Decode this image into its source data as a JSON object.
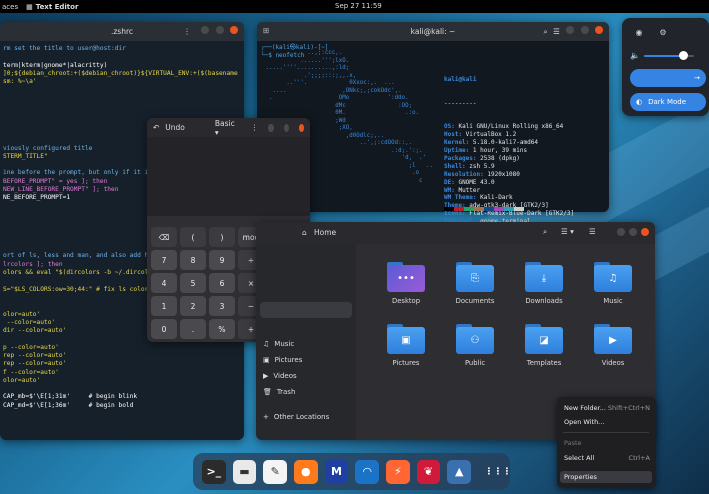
{
  "topbar": {
    "activities": "aces",
    "app_name": "Text Editor",
    "clock": "Sep 27  11:59"
  },
  "editor": {
    "title": ".zshrc",
    "lines": [
      {
        "t": "rm set the title to user@host:dir",
        "c": "c-comment"
      },
      {
        "t": "",
        "c": "c-plain"
      },
      {
        "t": "term|kterm|gnome*|alacritty)",
        "c": "c-plain"
      },
      {
        "t": "]0;${debian_chroot:+($debian_chroot)}${VIRTUAL_ENV:+($(basename",
        "c": "c-str"
      },
      {
        "t": "sm: %~\\a'",
        "c": "c-str"
      },
      {
        "t": "",
        "c": "c-plain"
      },
      {
        "t": "",
        "c": "c-plain"
      },
      {
        "t": "",
        "c": "c-plain"
      },
      {
        "t": "",
        "c": "c-plain"
      },
      {
        "t": "",
        "c": "c-plain"
      },
      {
        "t": "",
        "c": "c-plain"
      },
      {
        "t": "",
        "c": "c-plain"
      },
      {
        "t": "viously configured title",
        "c": "c-comment"
      },
      {
        "t": "STERM_TITLE\"",
        "c": "c-str"
      },
      {
        "t": "",
        "c": "c-plain"
      },
      {
        "t": "ine before the prompt, but only if it is",
        "c": "c-comment"
      },
      {
        "t": "BEFORE_PROMPT\" = yes ]; then",
        "c": "c-kw"
      },
      {
        "t": "NEW_LINE_BEFORE_PROMPT\" ]; then",
        "c": "c-kw"
      },
      {
        "t": "NE_BEFORE_PROMPT=1",
        "c": "c-plain"
      },
      {
        "t": "",
        "c": "c-plain"
      },
      {
        "t": "",
        "c": "c-plain"
      },
      {
        "t": "",
        "c": "c-plain"
      },
      {
        "t": "",
        "c": "c-plain"
      },
      {
        "t": "",
        "c": "c-plain"
      },
      {
        "t": "",
        "c": "c-plain"
      },
      {
        "t": "ort of ls, less and man, and also add ha",
        "c": "c-comment"
      },
      {
        "t": "lrcolors ]; then",
        "c": "c-kw"
      },
      {
        "t": "olors && eval \"$(dircolors -b ~/.dircolor",
        "c": "c-str"
      },
      {
        "t": "",
        "c": "c-plain"
      },
      {
        "t": "S=\"$LS_COLORS:ow=30;44:\" # fix ls color",
        "c": "c-str"
      },
      {
        "t": "",
        "c": "c-plain"
      },
      {
        "t": "",
        "c": "c-plain"
      },
      {
        "t": "olor=auto'",
        "c": "c-str"
      },
      {
        "t": " --color=auto'",
        "c": "c-str"
      },
      {
        "t": "dir --color=auto'",
        "c": "c-str"
      },
      {
        "t": "",
        "c": "c-plain"
      },
      {
        "t": "p --color=auto'",
        "c": "c-str"
      },
      {
        "t": "rep --color=auto'",
        "c": "c-str"
      },
      {
        "t": "rep --color=auto'",
        "c": "c-str"
      },
      {
        "t": "f --color=auto'",
        "c": "c-str"
      },
      {
        "t": "olor=auto'",
        "c": "c-str"
      },
      {
        "t": "",
        "c": "c-plain"
      },
      {
        "t": "CAP_mb=$'\\E[1;31m'     # begin blink",
        "c": "c-plain"
      },
      {
        "t": "CAP_md=$'\\E[1;36m'     # begin bold",
        "c": "c-plain"
      }
    ]
  },
  "terminal": {
    "title": "kali@kali: ~",
    "prompt": "┌──(kali㉿kali)-[~]",
    "command": "└─$ neofetch",
    "user_host": "kali@kali",
    "separator": "---------",
    "info": [
      {
        "k": "OS:",
        "v": " Kali GNU/Linux Rolling x86_64"
      },
      {
        "k": "Host:",
        "v": " VirtualBox 1.2"
      },
      {
        "k": "Kernel:",
        "v": " 5.18.0-kali7-amd64"
      },
      {
        "k": "Uptime:",
        "v": " 1 hour, 39 mins"
      },
      {
        "k": "Packages:",
        "v": " 2538 (dpkg)"
      },
      {
        "k": "Shell:",
        "v": " zsh 5.9"
      },
      {
        "k": "Resolution:",
        "v": " 1920x1080"
      },
      {
        "k": "DE:",
        "v": " GNOME 43.0"
      },
      {
        "k": "WM:",
        "v": " Mutter"
      },
      {
        "k": "WM Theme:",
        "v": " Kali-Dark"
      },
      {
        "k": "Theme:",
        "v": " adw-gtk3-dark [GTK2/3]"
      },
      {
        "k": "Icons:",
        "v": " Flat-Remix-Blue-Dark [GTK2/3]"
      },
      {
        "k": "Terminal:",
        "v": " gnome-terminal"
      },
      {
        "k": "CPU:",
        "v": " AMD Ryzen 7 3700X (2) @ 3.599GHz"
      },
      {
        "k": "GPU:",
        "v": " 00:02.0 VMware SVGA II Adapter"
      },
      {
        "k": "Memory:",
        "v": " 1928MiB / 3929MiB"
      }
    ],
    "ascii": "             ..,;:ccc,.\n           ......''';lxO.\n .....''''..........,:ld;\n            .';;;;:::;,,.x,\n       ..'''.            0Xxoc:,.  ...\n   ....                ,ONkc;,;cokOdc',.\n  .                   OMo           ':ddo.\n                     dMc               :OO;\n                     0M.                 .:o.\n                     ;Wd\n                      ;XO,\n                        ,d0Odlc;,..\n                            ..',;:cdOOd::,.\n                                     .:d;.':;.\n                                        'd,  .'\n                                          ;l   ..\n                                           .o\n                                             c",
    "swatches": [
      "#000000",
      "#c01c28",
      "#26a269",
      "#a2734c",
      "#12488b",
      "#a347ba",
      "#2aa1b3",
      "#d0cfcc"
    ]
  },
  "quick_settings": {
    "icons": [
      "camera-icon",
      "gear-icon"
    ],
    "volume_level": 0.78,
    "pill1_label": "",
    "pill2_label": "Dark Mode"
  },
  "calculator": {
    "title": "Undo",
    "mode": "Basic",
    "keys": [
      "⌫",
      "(",
      ")",
      "mod",
      "π",
      "7",
      "8",
      "9",
      "÷",
      "√",
      "4",
      "5",
      "6",
      "×",
      "x²",
      "1",
      "2",
      "3",
      "−",
      "=",
      "0",
      ".",
      "%",
      "+"
    ]
  },
  "files": {
    "path": "Home",
    "sidebar": [
      {
        "label": "Music",
        "icon": "music-icon"
      },
      {
        "label": "Pictures",
        "icon": "pictures-icon"
      },
      {
        "label": "Videos",
        "icon": "videos-icon"
      },
      {
        "label": "Trash",
        "icon": "trash-icon"
      },
      {
        "label": "Other Locations",
        "icon": "plus-icon"
      }
    ],
    "folders": [
      {
        "label": "Desktop",
        "icon": "desktop-folder-icon",
        "glyph": "•••",
        "desk": true
      },
      {
        "label": "Documents",
        "icon": "documents-folder-icon",
        "glyph": "⎘"
      },
      {
        "label": "Downloads",
        "icon": "downloads-folder-icon",
        "glyph": "⤓"
      },
      {
        "label": "Music",
        "icon": "music-folder-icon",
        "glyph": "♫"
      },
      {
        "label": "Pictures",
        "icon": "pictures-folder-icon",
        "glyph": "▣"
      },
      {
        "label": "Public",
        "icon": "public-folder-icon",
        "glyph": "⚇"
      },
      {
        "label": "Templates",
        "icon": "templates-folder-icon",
        "glyph": "◪"
      },
      {
        "label": "Videos",
        "icon": "videos-folder-icon",
        "glyph": "▶"
      }
    ]
  },
  "context_menu": {
    "items": [
      {
        "label": "New Folder...",
        "shortcut": "Shift+Ctrl+N",
        "disabled": false
      },
      {
        "label": "Open With...",
        "shortcut": "",
        "disabled": false
      },
      {
        "label": "Paste",
        "shortcut": "",
        "disabled": true
      },
      {
        "label": "Select All",
        "shortcut": "Ctrl+A",
        "disabled": false
      },
      {
        "label": "Properties",
        "shortcut": "",
        "disabled": false
      }
    ]
  },
  "dock": {
    "apps": [
      {
        "name": "terminal-app",
        "glyph": ">_",
        "bg": "#2b2b2b"
      },
      {
        "name": "files-app",
        "glyph": "▬",
        "bg": "#e9e9e9"
      },
      {
        "name": "text-editor-app",
        "glyph": "✎",
        "bg": "#f4f4f4"
      },
      {
        "name": "firefox-app",
        "glyph": "●",
        "bg": "#ff7a1a"
      },
      {
        "name": "metasploit-app",
        "glyph": "M",
        "bg": "#1f3fa3"
      },
      {
        "name": "wireshark-app",
        "glyph": "◠",
        "bg": "#1a73c7"
      },
      {
        "name": "burpsuite-app",
        "glyph": "⚡",
        "bg": "#ff6633"
      },
      {
        "name": "cherrytree-app",
        "glyph": "❦",
        "bg": "#d11a3a"
      },
      {
        "name": "kali-tweaks-app",
        "glyph": "▲",
        "bg": "#3a6fb0"
      },
      {
        "name": "app-grid",
        "glyph": "⋮⋮⋮",
        "bg": "transparent"
      }
    ]
  }
}
